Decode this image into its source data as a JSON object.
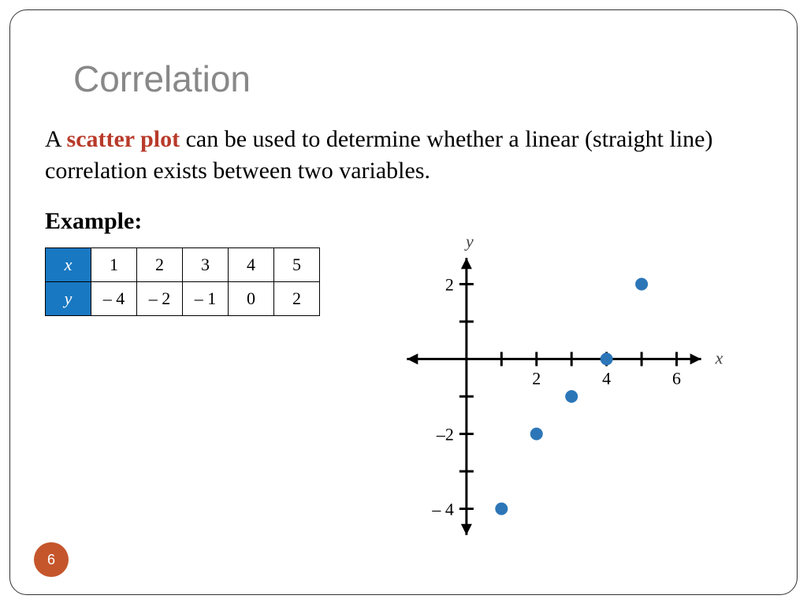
{
  "title": "Correlation",
  "body_prefix": "A ",
  "body_term": "scatter plot",
  "body_suffix": " can be used to determine whether a linear (straight line) correlation exists between two variables.",
  "example_label": "Example:",
  "table": {
    "row1_header": "x",
    "row2_header": "y",
    "cols": [
      "1",
      "2",
      "3",
      "4",
      "5"
    ],
    "vals": [
      "– 4",
      "– 2",
      "– 1",
      "0",
      "2"
    ]
  },
  "chart_data": {
    "type": "scatter",
    "x": [
      1,
      2,
      3,
      4,
      5
    ],
    "y": [
      -4,
      -2,
      -1,
      0,
      2
    ],
    "xlabel": "x",
    "ylabel": "y",
    "xlim": [
      -2,
      7
    ],
    "ylim": [
      -5,
      3
    ],
    "x_ticks": [
      1,
      2,
      3,
      4,
      5,
      6
    ],
    "x_tick_labels": {
      "2": "2",
      "4": "4",
      "6": "6"
    },
    "y_ticks": [
      -4,
      -3,
      -2,
      -1,
      1,
      2
    ],
    "y_tick_labels": {
      "2": "2",
      "-2": "–2",
      "-4": "– 4"
    }
  },
  "page_number": "6"
}
